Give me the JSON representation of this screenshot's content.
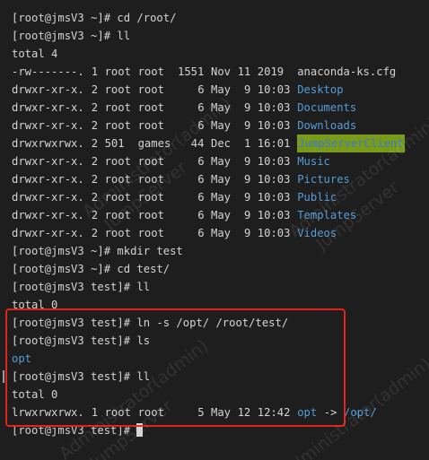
{
  "watermark": {
    "line1": "Administrator(admin)",
    "line2": "JumpServer"
  },
  "lines": [
    {
      "text": "[root@jmsV3 ~]# cd /root/"
    },
    {
      "text": "[root@jmsV3 ~]# ll"
    },
    {
      "text": "total 4"
    },
    {
      "perm": "-rw-------.",
      "links": "1",
      "owner": "root",
      "group": "root",
      "size": "1551",
      "month": "Nov",
      "day": "11",
      "time": "2019",
      "name": "anaconda-ks.cfg",
      "style": "plain"
    },
    {
      "perm": "drwxr-xr-x.",
      "links": "2",
      "owner": "root",
      "group": "root",
      "size": "6",
      "month": "May",
      "day": "9",
      "time": "10:03",
      "name": "Desktop",
      "style": "dir"
    },
    {
      "perm": "drwxr-xr-x.",
      "links": "2",
      "owner": "root",
      "group": "root",
      "size": "6",
      "month": "May",
      "day": "9",
      "time": "10:03",
      "name": "Documents",
      "style": "dir"
    },
    {
      "perm": "drwxr-xr-x.",
      "links": "2",
      "owner": "root",
      "group": "root",
      "size": "6",
      "month": "May",
      "day": "9",
      "time": "10:03",
      "name": "Downloads",
      "style": "dir"
    },
    {
      "perm": "drwxrwxrwx.",
      "links": "2",
      "owner": "501",
      "group": "games",
      "size": "44",
      "month": "Dec",
      "day": "1",
      "time": "16:01",
      "name": "JumpServerClient",
      "style": "hl-dir"
    },
    {
      "perm": "drwxr-xr-x.",
      "links": "2",
      "owner": "root",
      "group": "root",
      "size": "6",
      "month": "May",
      "day": "9",
      "time": "10:03",
      "name": "Music",
      "style": "dir"
    },
    {
      "perm": "drwxr-xr-x.",
      "links": "2",
      "owner": "root",
      "group": "root",
      "size": "6",
      "month": "May",
      "day": "9",
      "time": "10:03",
      "name": "Pictures",
      "style": "dir"
    },
    {
      "perm": "drwxr-xr-x.",
      "links": "2",
      "owner": "root",
      "group": "root",
      "size": "6",
      "month": "May",
      "day": "9",
      "time": "10:03",
      "name": "Public",
      "style": "dir"
    },
    {
      "perm": "drwxr-xr-x.",
      "links": "2",
      "owner": "root",
      "group": "root",
      "size": "6",
      "month": "May",
      "day": "9",
      "time": "10:03",
      "name": "Templates",
      "style": "dir"
    },
    {
      "perm": "drwxr-xr-x.",
      "links": "2",
      "owner": "root",
      "group": "root",
      "size": "6",
      "month": "May",
      "day": "9",
      "time": "10:03",
      "name": "Videos",
      "style": "dir"
    },
    {
      "text": "[root@jmsV3 ~]# mkdir test"
    },
    {
      "text": "[root@jmsV3 ~]# cd test/"
    },
    {
      "text": "[root@jmsV3 test]# ll"
    },
    {
      "text": "total 0"
    },
    {
      "text": "[root@jmsV3 test]# ln -s /opt/ /root/test/"
    },
    {
      "text": "[root@jmsV3 test]# ls"
    },
    {
      "text": "opt",
      "style": "dir"
    },
    {
      "text": "[root@jmsV3 test]# ll"
    },
    {
      "text": "total 0"
    },
    {
      "perm": "lrwxrwxrwx.",
      "links": "1",
      "owner": "root",
      "group": "root",
      "size": "5",
      "month": "May",
      "day": "12",
      "time": "12:42",
      "name": "opt",
      "arrow": "->",
      "target": "/opt/",
      "style": "dir"
    },
    {
      "text": "[root@jmsV3 test]# ",
      "cursor": true
    }
  ]
}
